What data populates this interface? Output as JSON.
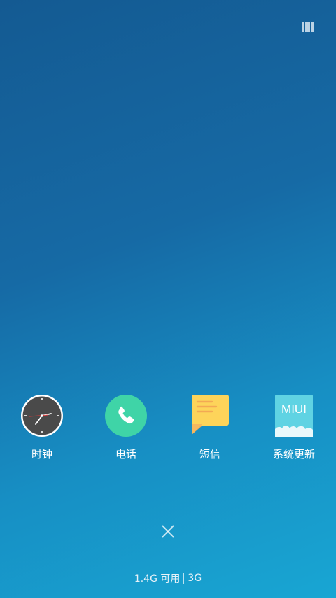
{
  "top_icon": "recent-tasks-icon",
  "apps": [
    {
      "label": "时钟",
      "icon": "clock-icon"
    },
    {
      "label": "电话",
      "icon": "phone-icon"
    },
    {
      "label": "短信",
      "icon": "sms-icon"
    },
    {
      "label": "系统更新",
      "icon": "system-update-icon",
      "icon_text": "MIUI"
    }
  ],
  "close_icon": "close-icon",
  "storage": {
    "available": "1.4G 可用",
    "network": "3G"
  },
  "colors": {
    "background_top": "#145a92",
    "background_bottom": "#18a6d3",
    "phone_green": "#3fd4a7",
    "sms_yellow": "#fdd45a",
    "sms_orange": "#f3a954",
    "miui_cyan": "#5fd3e3"
  }
}
